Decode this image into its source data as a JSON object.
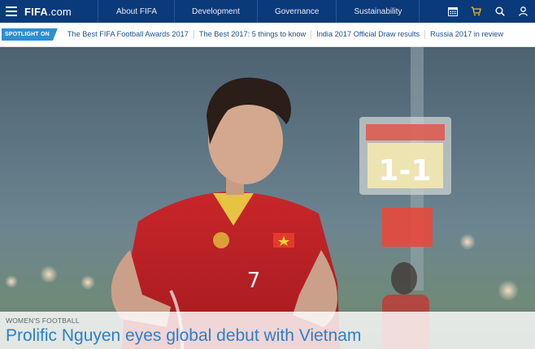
{
  "header": {
    "logo_main": "FIFA",
    "logo_suffix": ".com",
    "nav": [
      "About FIFA",
      "Development",
      "Governance",
      "Sustainability"
    ],
    "icons": [
      "calendar-icon",
      "cart-icon",
      "search-icon",
      "user-icon"
    ],
    "colors": {
      "background": "#0a3a7a",
      "accent_cart": "#f2c21a"
    }
  },
  "spotlight": {
    "badge": "SPOTLIGHT ON",
    "links": [
      "The Best FIFA Football Awards 2017",
      "The Best 2017: 5 things to know",
      "India 2017 Official Draw results",
      "Russia 2017 in review"
    ],
    "badge_color": "#2d8fd4"
  },
  "hero": {
    "image": "Vietnam women's football player in red jersey number 7, stadium lights in background",
    "category": "WOMEN'S FOOTBALL",
    "headline": "Prolific Nguyen eyes global debut with Vietnam",
    "scoreboard": "1-1",
    "jersey_number": "7"
  }
}
